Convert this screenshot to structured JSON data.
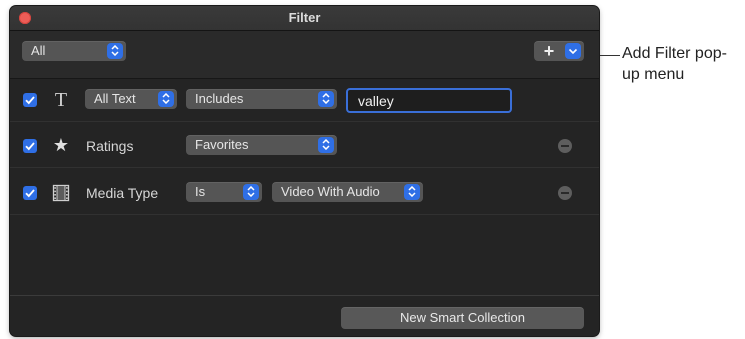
{
  "window": {
    "title": "Filter"
  },
  "match_popup": {
    "value": "All"
  },
  "add_filter": {
    "plus_label": "+"
  },
  "rows": [
    {
      "icon": "text-icon",
      "icon_glyph": "T",
      "checked": true,
      "field_popup": "All Text",
      "operator_popup": "Includes",
      "value_field": "valley"
    },
    {
      "icon": "star-icon",
      "icon_glyph": "★",
      "checked": true,
      "label": "Ratings",
      "value_popup": "Favorites"
    },
    {
      "icon": "film-icon",
      "checked": true,
      "label": "Media Type",
      "operator_popup": "Is",
      "value_popup": "Video With Audio"
    }
  ],
  "footer": {
    "button_label": "New Smart Collection"
  },
  "callout": {
    "text": "Add Filter pop-up menu"
  },
  "colors": {
    "accent": "#2f6fe6",
    "window_bg": "#242424",
    "close_button": "#ed5d57",
    "popup_bg": "#555555"
  }
}
